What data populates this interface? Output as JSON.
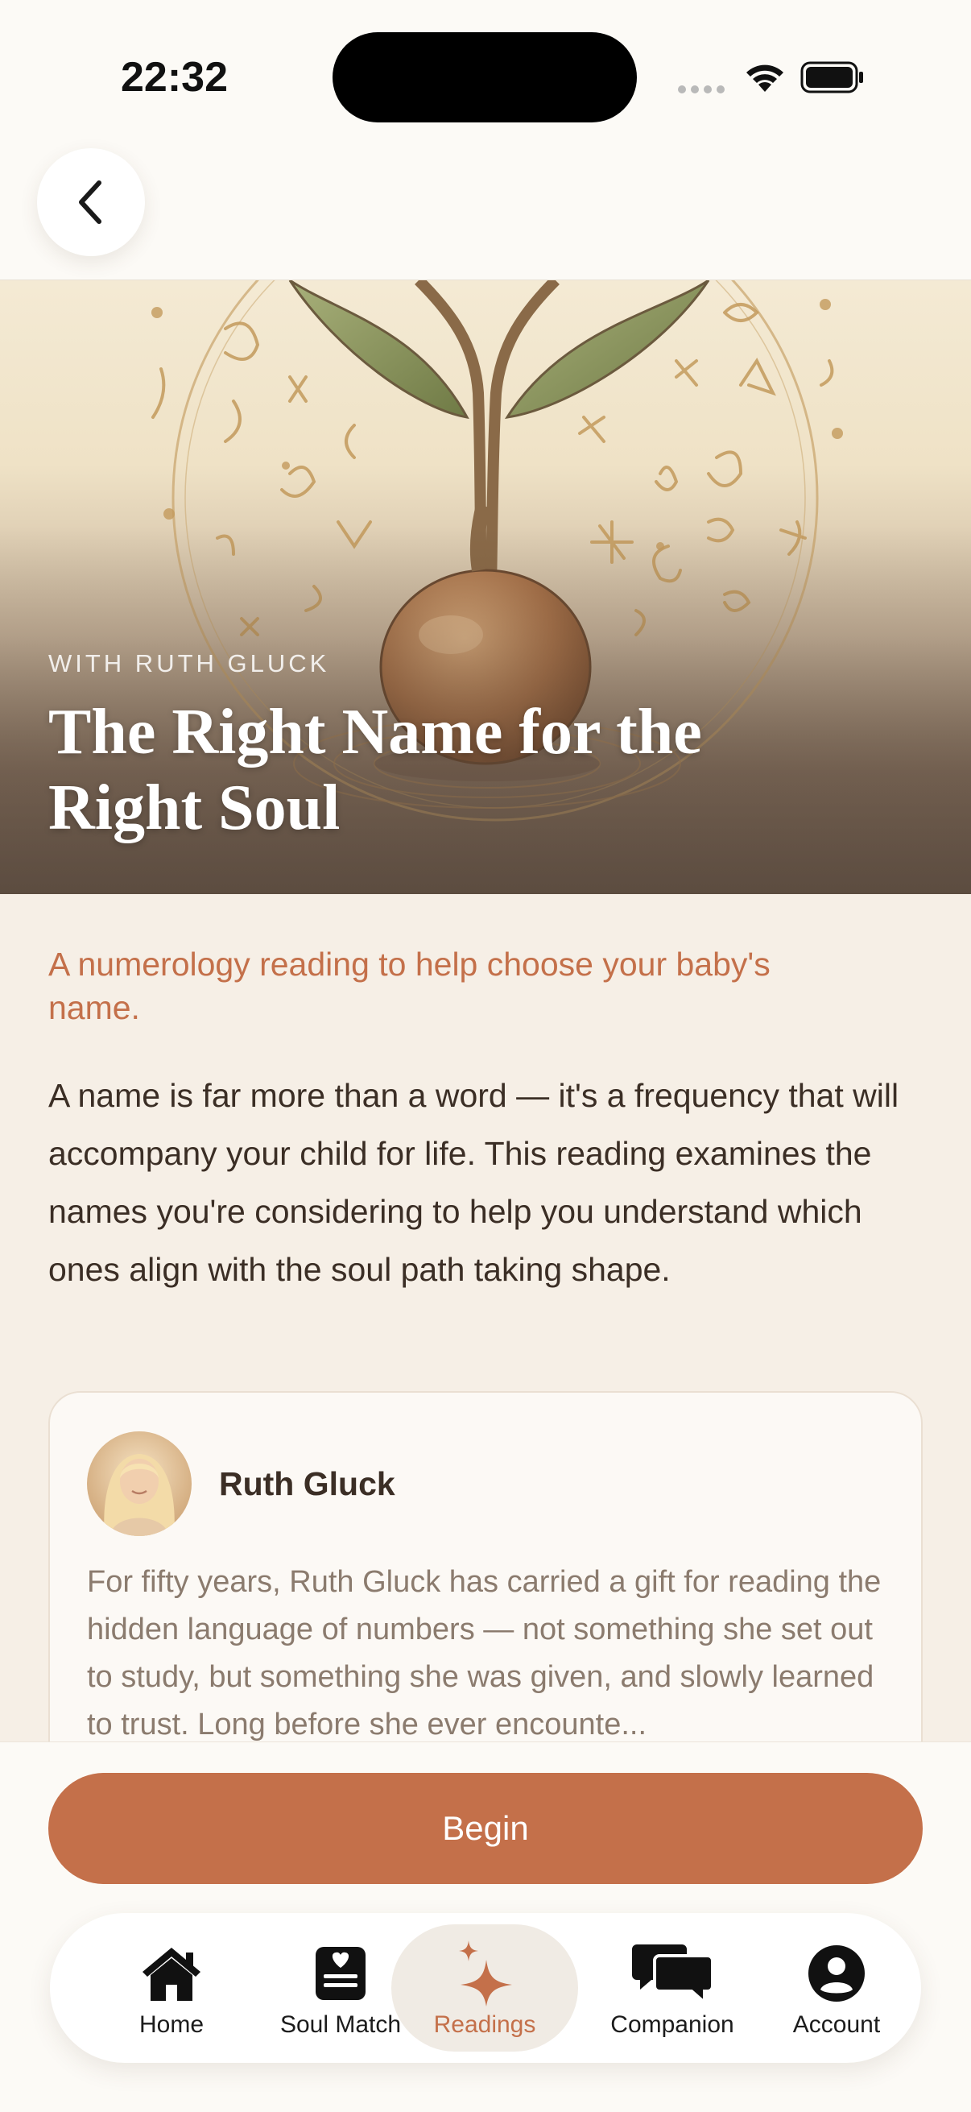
{
  "status_bar": {
    "time": "22:32"
  },
  "hero": {
    "kicker": "WITH RUTH GLUCK",
    "title": "The Right Name for the Right Soul"
  },
  "content": {
    "subtitle": "A numerology reading to help choose your baby's name.",
    "description": "A name is far more than a word — it's a frequency that will accompany your child for life. This reading examines the names you're considering to help you understand which ones align with the soul path taking shape."
  },
  "author_card": {
    "name": "Ruth Gluck",
    "bio": "For fifty years, Ruth Gluck has carried a gift for reading the hidden language of numbers — not something she set out to study, but something she was given, and slowly learned to trust. Long before she ever encounte..."
  },
  "cta": {
    "label": "Begin"
  },
  "tabs": [
    {
      "label": "Home",
      "icon": "home-icon",
      "active": false
    },
    {
      "label": "Soul Match",
      "icon": "soul-match-icon",
      "active": false
    },
    {
      "label": "Readings",
      "icon": "sparkle-icon",
      "active": true
    },
    {
      "label": "Companion",
      "icon": "chat-bubbles-icon",
      "active": false
    },
    {
      "label": "Account",
      "icon": "account-icon",
      "active": false
    }
  ],
  "colors": {
    "accent": "#c4704a",
    "background": "#f6efe6",
    "tab_active_bg": "#f0ebe4"
  }
}
